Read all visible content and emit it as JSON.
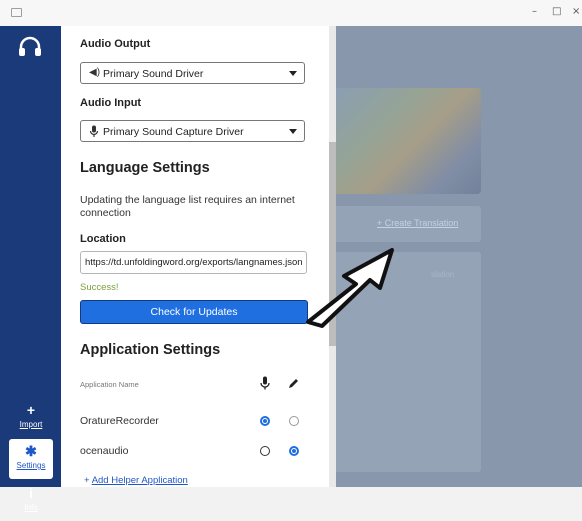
{
  "window": {
    "minimize": "–",
    "maximize": "□",
    "close": "×"
  },
  "nav": {
    "import": {
      "glyph": "+",
      "label": "Import",
      "icon": "plus-icon"
    },
    "settings": {
      "glyph": "✱",
      "label": "Settings",
      "icon": "gear-icon"
    },
    "info": {
      "glyph": "i",
      "label": "Info",
      "icon": "info-icon"
    },
    "top_icon": "headset-icon"
  },
  "settings": {
    "audio_output": {
      "label": "Audio Output",
      "value": "Primary Sound Driver",
      "icon": "speaker-icon"
    },
    "audio_input": {
      "label": "Audio Input",
      "value": "Primary Sound Capture Driver",
      "icon": "mic-icon"
    },
    "language": {
      "title": "Language Settings",
      "description": "Updating the language list requires an internet connection",
      "location_label": "Location",
      "location_value": "https://td.unfoldingword.org/exports/langnames.json",
      "status": "Success!",
      "check_button": "Check for Updates"
    },
    "app_settings": {
      "title": "Application Settings",
      "column_header": "Application Name",
      "rows": [
        {
          "name": "OratureRecorder",
          "record": true,
          "edit": false
        },
        {
          "name": "ocenaudio",
          "record": false,
          "edit": true
        }
      ],
      "add_helper": "Add Helper Application",
      "add_icon": "+"
    }
  },
  "background": {
    "create_translation": "+ Create Translation",
    "faded_text": "slation"
  },
  "colors": {
    "nav_bg": "#1a3a7a",
    "accent": "#1f6fe0",
    "success": "#7aa13a"
  }
}
